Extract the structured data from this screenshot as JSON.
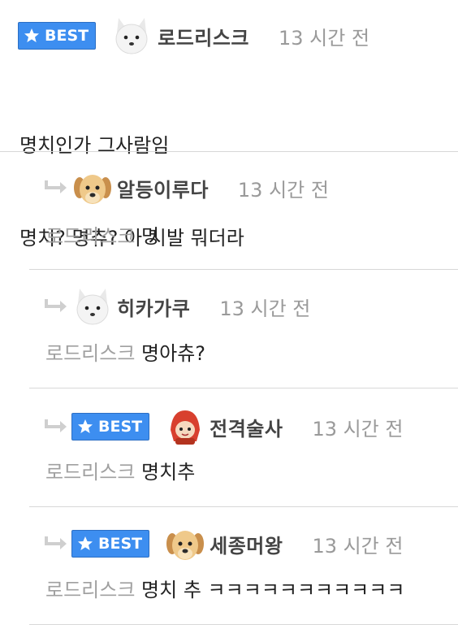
{
  "colors": {
    "badge": "#3d8ef0",
    "muted": "#9a9a9a",
    "text": "#222222"
  },
  "badge_label": "BEST",
  "top_comment": {
    "avatar_icon": "arctic-fox-icon",
    "nickname": "로드리스크",
    "time": "13 시간 전",
    "lines": [
      "명치인가 그사람임",
      "명치? 명츄? 아 시발 뭐더라"
    ]
  },
  "replies": [
    {
      "best": false,
      "avatar_icon": "puppy-icon",
      "nickname": "알등이루다",
      "time": "13 시간 전",
      "reply_to": "로드리스크",
      "text": "명"
    },
    {
      "best": false,
      "avatar_icon": "arctic-fox-icon",
      "nickname": "히카가쿠",
      "time": "13 시간 전",
      "reply_to": "로드리스크",
      "text": "명아츄?"
    },
    {
      "best": true,
      "avatar_icon": "red-hood-icon",
      "nickname": "전격술사",
      "time": "13 시간 전",
      "reply_to": "로드리스크",
      "text": "명치추"
    },
    {
      "best": true,
      "avatar_icon": "puppy-icon",
      "nickname": "세종머왕",
      "time": "13 시간 전",
      "reply_to": "로드리스크",
      "text": "명치 추 ㅋㅋㅋㅋㅋㅋㅋㅋㅋㅋㅋ"
    }
  ]
}
